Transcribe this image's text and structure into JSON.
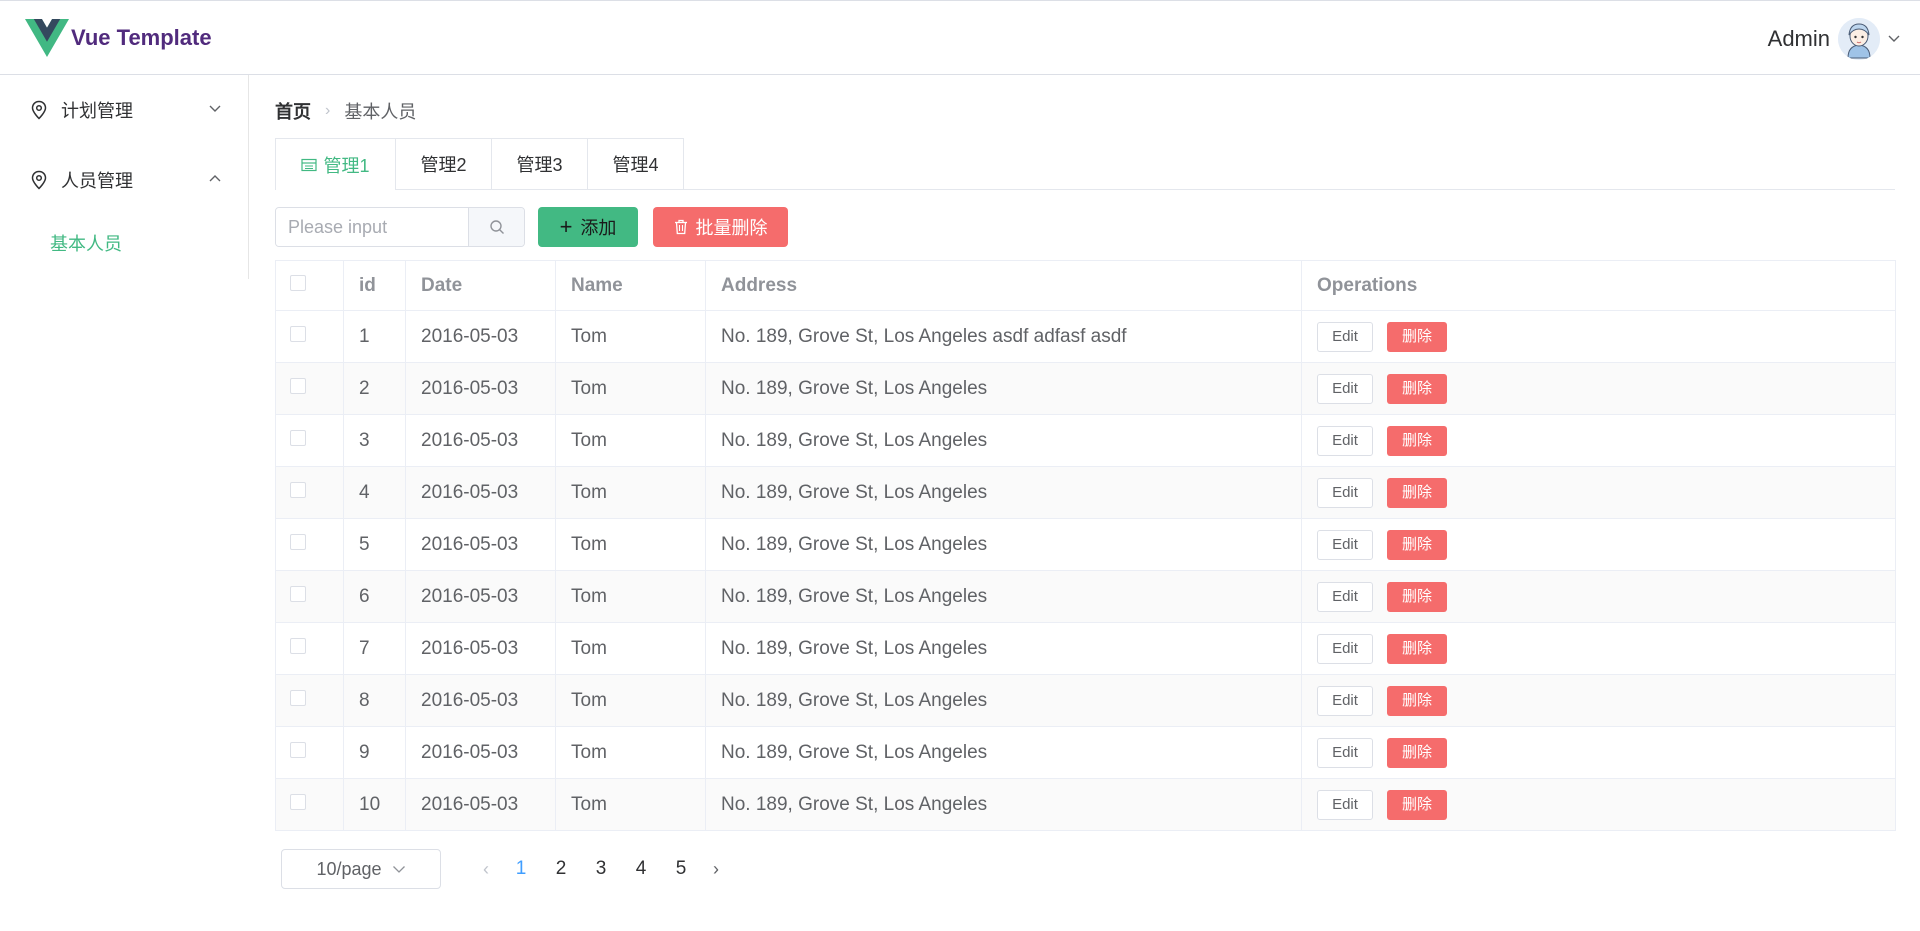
{
  "header": {
    "app_title": "Vue Template",
    "user_name": "Admin"
  },
  "sidebar": {
    "menus": [
      {
        "label": "计划管理",
        "expanded": false
      },
      {
        "label": "人员管理",
        "expanded": true
      }
    ],
    "active_sub_item": "基本人员"
  },
  "breadcrumb": {
    "home": "首页",
    "current": "基本人员"
  },
  "tabs": [
    {
      "label": "管理1",
      "active": true
    },
    {
      "label": "管理2",
      "active": false
    },
    {
      "label": "管理3",
      "active": false
    },
    {
      "label": "管理4",
      "active": false
    }
  ],
  "toolbar": {
    "search_placeholder": "Please input",
    "search_value": "",
    "add_label": "添加",
    "batch_delete_label": "批量删除"
  },
  "table": {
    "columns": [
      "id",
      "Date",
      "Name",
      "Address",
      "Operations"
    ],
    "rows": [
      {
        "id": "1",
        "date": "2016-05-03",
        "name": "Tom",
        "address": "No. 189, Grove St, Los Angeles asdf adfasf asdf"
      },
      {
        "id": "2",
        "date": "2016-05-03",
        "name": "Tom",
        "address": "No. 189, Grove St, Los Angeles"
      },
      {
        "id": "3",
        "date": "2016-05-03",
        "name": "Tom",
        "address": "No. 189, Grove St, Los Angeles"
      },
      {
        "id": "4",
        "date": "2016-05-03",
        "name": "Tom",
        "address": "No. 189, Grove St, Los Angeles"
      },
      {
        "id": "5",
        "date": "2016-05-03",
        "name": "Tom",
        "address": "No. 189, Grove St, Los Angeles"
      },
      {
        "id": "6",
        "date": "2016-05-03",
        "name": "Tom",
        "address": "No. 189, Grove St, Los Angeles"
      },
      {
        "id": "7",
        "date": "2016-05-03",
        "name": "Tom",
        "address": "No. 189, Grove St, Los Angeles"
      },
      {
        "id": "8",
        "date": "2016-05-03",
        "name": "Tom",
        "address": "No. 189, Grove St, Los Angeles"
      },
      {
        "id": "9",
        "date": "2016-05-03",
        "name": "Tom",
        "address": "No. 189, Grove St, Los Angeles"
      },
      {
        "id": "10",
        "date": "2016-05-03",
        "name": "Tom",
        "address": "No. 189, Grove St, Los Angeles"
      }
    ],
    "edit_label": "Edit",
    "delete_label": "删除"
  },
  "pagination": {
    "page_size_label": "10/page",
    "pages": [
      "1",
      "2",
      "3",
      "4",
      "5"
    ],
    "current_page": "1"
  },
  "colors": {
    "accent_green": "#42b983",
    "danger_red": "#f56c6c",
    "brand_purple": "#512b7d",
    "page_active_blue": "#409eff"
  }
}
